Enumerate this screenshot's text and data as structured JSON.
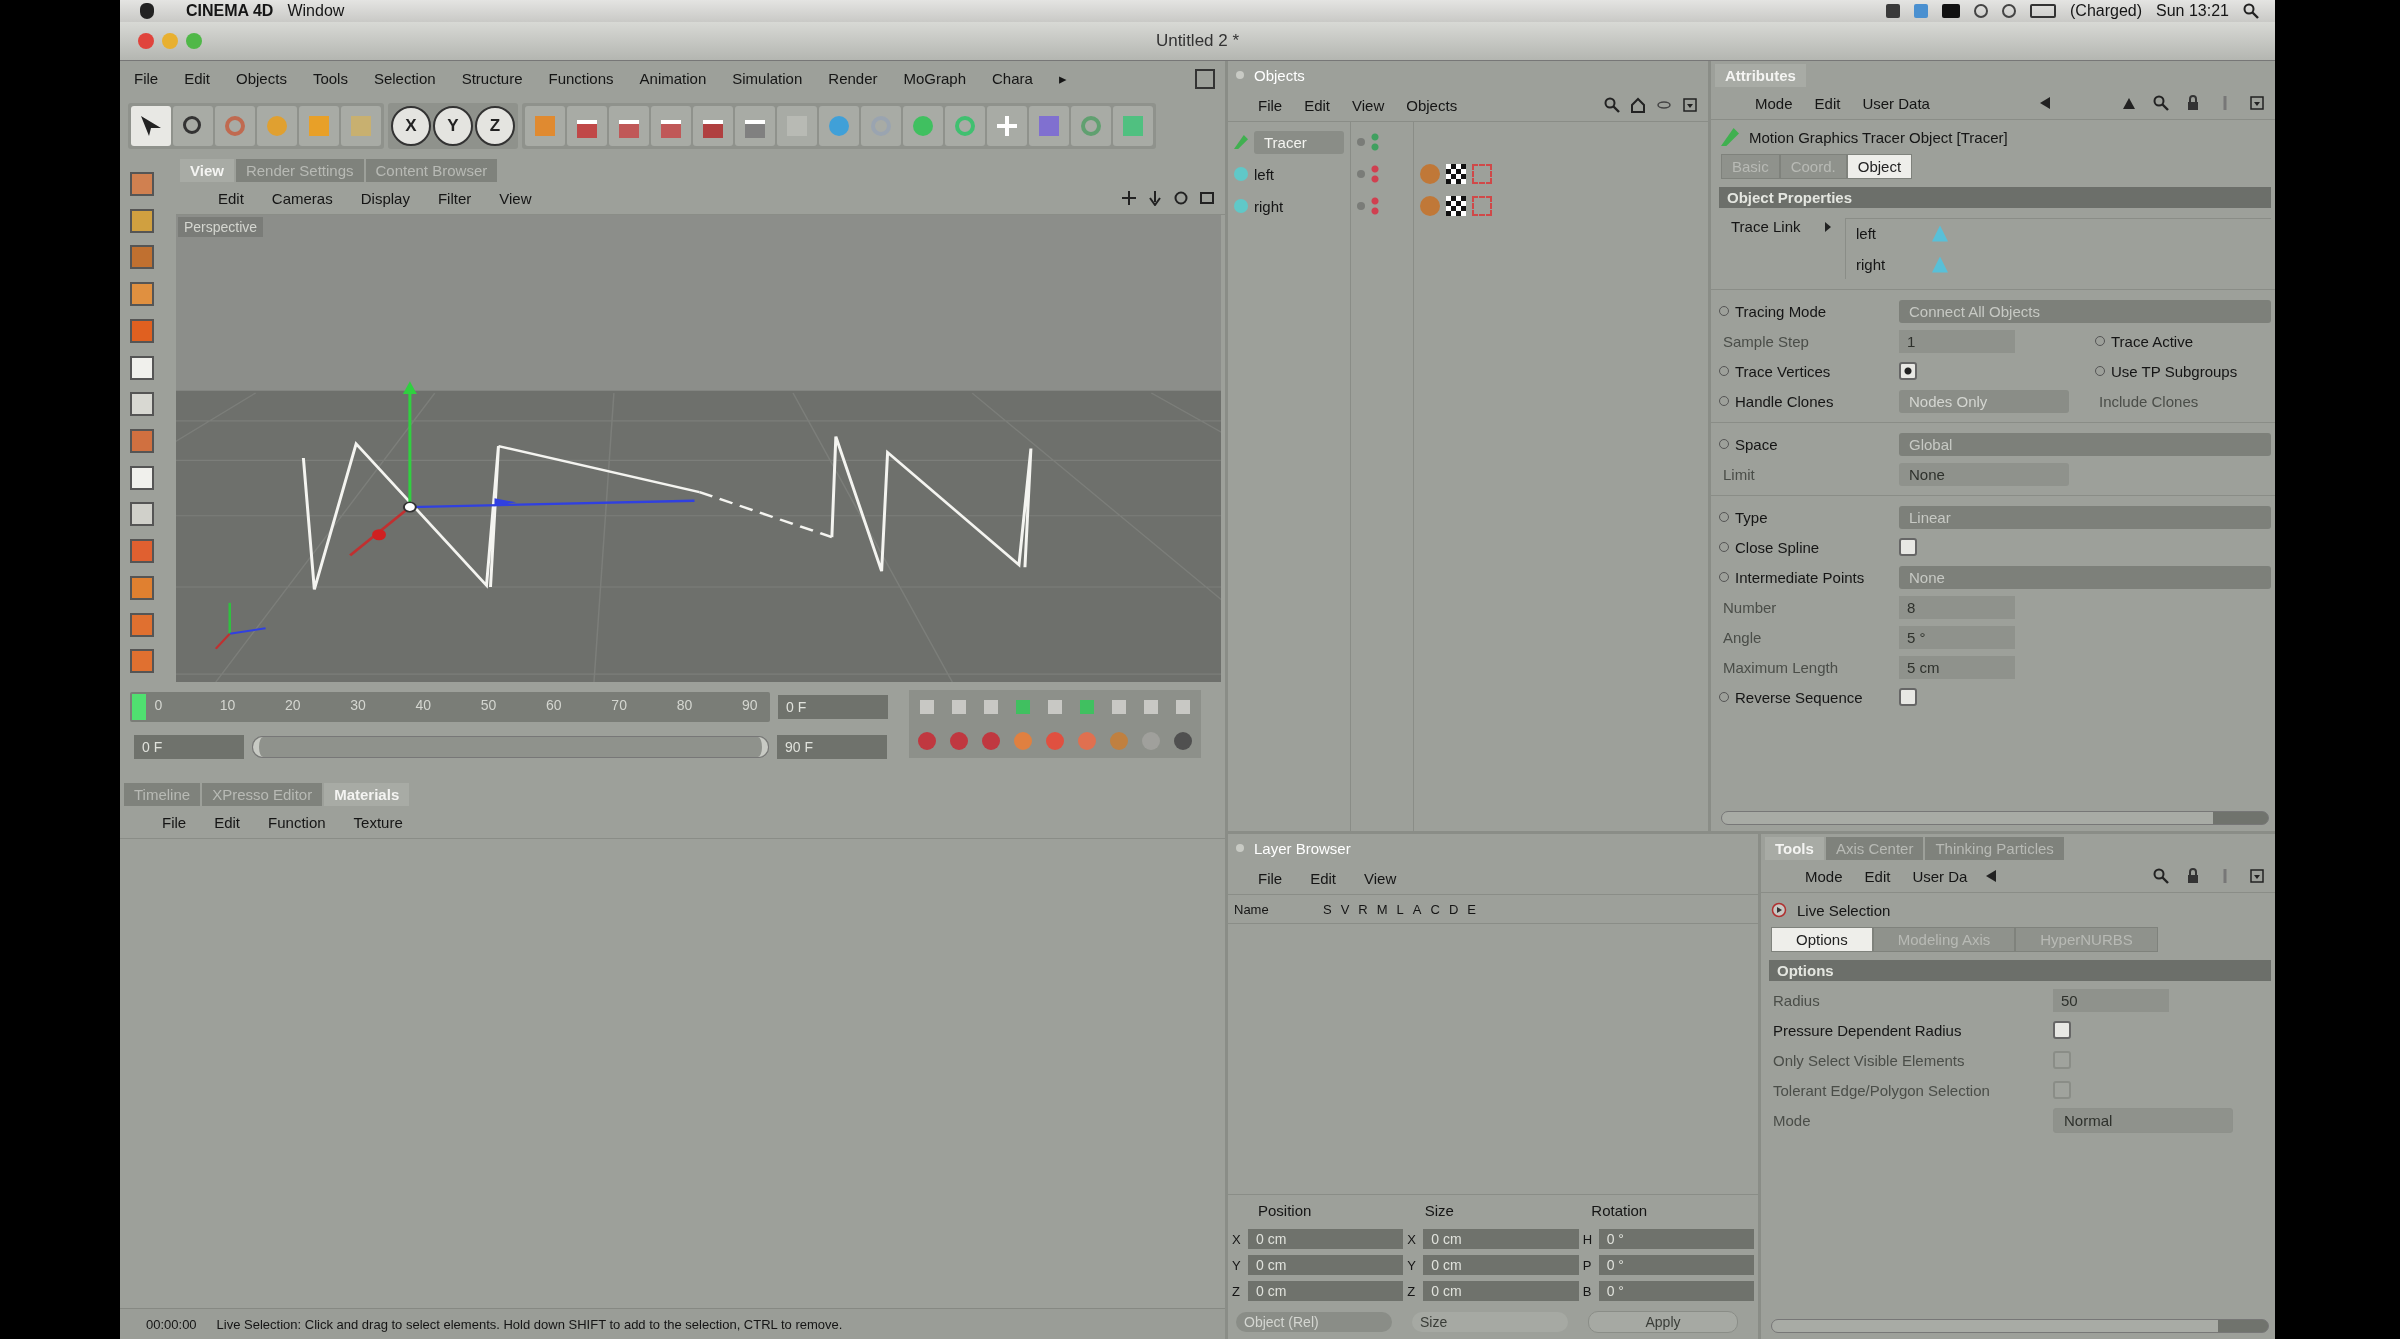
{
  "system_bar": {
    "app": "CINEMA 4D",
    "menus": [
      "Window"
    ],
    "battery": "(Charged)",
    "clock": "Sun 13:21"
  },
  "window": {
    "title": "Untitled 2 *"
  },
  "menu": {
    "items": [
      "File",
      "Edit",
      "Objects",
      "Tools",
      "Selection",
      "Structure",
      "Functions",
      "Animation",
      "Simulation",
      "Render",
      "MoGraph",
      "Chara"
    ],
    "overflow": "▸"
  },
  "toolbar": {
    "axis_buttons": [
      "X",
      "Y",
      "Z"
    ]
  },
  "viewport": {
    "tabs": [
      {
        "label": "View",
        "selected": true
      },
      {
        "label": "Render Settings",
        "selected": false
      },
      {
        "label": "Content Browser",
        "selected": false
      }
    ],
    "menu": [
      "Edit",
      "Cameras",
      "Display",
      "Filter",
      "View"
    ],
    "camera": "Perspective"
  },
  "timeline": {
    "ticks": [
      "0",
      "10",
      "20",
      "30",
      "40",
      "50",
      "60",
      "70",
      "80",
      "90"
    ],
    "current": "0 F",
    "start": "0 F",
    "end": "90 F",
    "range": {
      "level": 1
    }
  },
  "materials": {
    "tabs": [
      {
        "label": "Timeline",
        "selected": false
      },
      {
        "label": "XPresso Editor",
        "selected": false
      },
      {
        "label": "Materials",
        "selected": true
      }
    ],
    "menu": [
      "File",
      "Edit",
      "Function",
      "Texture"
    ]
  },
  "status_bar": {
    "time": "00:00:00",
    "message": "Live Selection: Click and drag to select elements. Hold down SHIFT to add to the selection, CTRL to remove."
  },
  "objects": {
    "title": "Objects",
    "menu": [
      "File",
      "Edit",
      "View",
      "Objects"
    ],
    "items": [
      {
        "name": "Tracer",
        "kind": "tracer",
        "selected": true
      },
      {
        "name": "left",
        "kind": "null",
        "selected": false
      },
      {
        "name": "right",
        "kind": "null",
        "selected": false
      }
    ]
  },
  "attributes": {
    "title": "Attributes",
    "menu": [
      "Mode",
      "Edit",
      "User Data"
    ],
    "object_title": "Motion Graphics Tracer Object [Tracer]",
    "tabs": [
      {
        "label": "Basic",
        "selected": false
      },
      {
        "label": "Coord.",
        "selected": false
      },
      {
        "label": "Object",
        "selected": true
      }
    ],
    "section": "Object Properties",
    "trace_link": {
      "label": "Trace Link",
      "items": [
        "left",
        "right"
      ]
    },
    "groups": [
      [
        {
          "kind": "bar",
          "label": "Tracing Mode",
          "value": "Connect All Objects",
          "disabled": false
        },
        {
          "kind": "number",
          "label": "Sample Step",
          "value": "1",
          "disabled": true,
          "extra": {
            "label": "Trace Active",
            "disabled": false
          }
        },
        {
          "kind": "checkbox",
          "label": "Trace Vertices",
          "checked": true,
          "disabled": false,
          "extra": {
            "label": "Use TP Subgroups",
            "disabled": false
          }
        },
        {
          "kind": "select",
          "label": "Handle Clones",
          "value": "Nodes Only",
          "disabled": false,
          "extra": {
            "label": "Include Clones",
            "disabled": true
          }
        }
      ],
      [
        {
          "kind": "bar",
          "label": "Space",
          "value": "Global",
          "disabled": false
        },
        {
          "kind": "select",
          "label": "Limit",
          "value": "None",
          "disabled": true
        }
      ],
      [
        {
          "kind": "bar",
          "label": "Type",
          "value": "Linear",
          "disabled": false
        },
        {
          "kind": "checkbox",
          "label": "Close Spline",
          "checked": false,
          "disabled": false
        },
        {
          "kind": "bar",
          "label": "Intermediate Points",
          "value": "None",
          "disabled": false
        },
        {
          "kind": "number",
          "label": "Number",
          "value": "8",
          "disabled": true
        },
        {
          "kind": "number",
          "label": "Angle",
          "value": "5 °",
          "disabled": true
        },
        {
          "kind": "number",
          "label": "Maximum Length",
          "value": "5 cm",
          "disabled": true
        },
        {
          "kind": "checkbox",
          "label": "Reverse Sequence",
          "checked": false,
          "disabled": false
        }
      ]
    ]
  },
  "layers": {
    "title": "Layer Browser",
    "menu": [
      "File",
      "Edit",
      "View"
    ],
    "columns": [
      "Name",
      "S",
      "V",
      "R",
      "M",
      "L",
      "A",
      "C",
      "D",
      "E"
    ]
  },
  "coordinates": {
    "headers": [
      "Position",
      "Size",
      "Rotation"
    ],
    "columns": [
      [
        {
          "axis": "X",
          "value": "0 cm"
        },
        {
          "axis": "Y",
          "value": "0 cm"
        },
        {
          "axis": "Z",
          "value": "0 cm"
        }
      ],
      [
        {
          "axis": "X",
          "value": "0 cm"
        },
        {
          "axis": "Y",
          "value": "0 cm"
        },
        {
          "axis": "Z",
          "value": "0 cm"
        }
      ],
      [
        {
          "axis": "H",
          "value": "0 °"
        },
        {
          "axis": "P",
          "value": "0 °"
        },
        {
          "axis": "B",
          "value": "0 °"
        }
      ]
    ],
    "mode": "Object (Rel)",
    "size_mode": "Size",
    "apply": "Apply"
  },
  "tools": {
    "tabs": [
      {
        "label": "Tools",
        "selected": true
      },
      {
        "label": "Axis Center",
        "selected": false
      },
      {
        "label": "Thinking Particles",
        "selected": false
      }
    ],
    "menu": [
      "Mode",
      "Edit",
      "User Da"
    ],
    "tool_title": "Live Selection",
    "subtabs": [
      {
        "label": "Options",
        "selected": true
      },
      {
        "label": "Modeling Axis",
        "selected": false
      },
      {
        "label": "HyperNURBS",
        "selected": false
      }
    ],
    "section": "Options",
    "rows": [
      {
        "kind": "number",
        "label": "Radius",
        "value": "50",
        "disabled": true
      },
      {
        "kind": "checkbox",
        "label": "Pressure Dependent Radius",
        "checked": false,
        "disabled": false
      },
      {
        "kind": "checkbox",
        "label": "Only Select Visible Elements",
        "checked": false,
        "disabled": true
      },
      {
        "kind": "checkbox",
        "label": "Tolerant Edge/Polygon Selection",
        "checked": false,
        "disabled": true
      },
      {
        "kind": "select",
        "label": "Mode",
        "value": "Normal",
        "disabled": true
      }
    ]
  }
}
